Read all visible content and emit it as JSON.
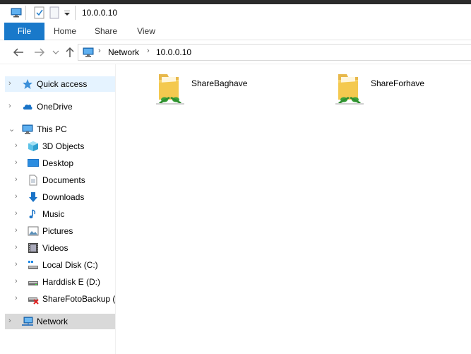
{
  "window": {
    "title": "10.0.0.10"
  },
  "ribbon": {
    "tabs": [
      {
        "label": "File"
      },
      {
        "label": "Home"
      },
      {
        "label": "Share"
      },
      {
        "label": "View"
      }
    ]
  },
  "address": {
    "crumbs": [
      {
        "label": "Network"
      },
      {
        "label": "10.0.0.10"
      }
    ]
  },
  "sidebar": {
    "items": [
      {
        "label": "Quick access",
        "icon": "star-icon"
      },
      {
        "label": "OneDrive",
        "icon": "cloud-icon"
      },
      {
        "label": "This PC",
        "icon": "monitor-icon"
      },
      {
        "label": "3D Objects",
        "icon": "cube-icon"
      },
      {
        "label": "Desktop",
        "icon": "desktop-icon"
      },
      {
        "label": "Documents",
        "icon": "document-icon"
      },
      {
        "label": "Downloads",
        "icon": "download-arrow-icon"
      },
      {
        "label": "Music",
        "icon": "music-note-icon"
      },
      {
        "label": "Pictures",
        "icon": "picture-icon"
      },
      {
        "label": "Videos",
        "icon": "film-icon"
      },
      {
        "label": "Local Disk (C:)",
        "icon": "local-disk-icon"
      },
      {
        "label": "Harddisk E (D:)",
        "icon": "hard-disk-icon"
      },
      {
        "label": "ShareFotoBackup (\\",
        "icon": "disconnected-drive-icon"
      },
      {
        "label": "Network",
        "icon": "network-icon"
      }
    ]
  },
  "shares": [
    {
      "label": "ShareBaghave",
      "icon": "shared-folder-icon"
    },
    {
      "label": "ShareForhave",
      "icon": "shared-folder-icon"
    }
  ],
  "colors": {
    "accent": "#1979ca",
    "selected_bg": "#e5f3ff",
    "hover_bg": "#d9d9d9"
  }
}
